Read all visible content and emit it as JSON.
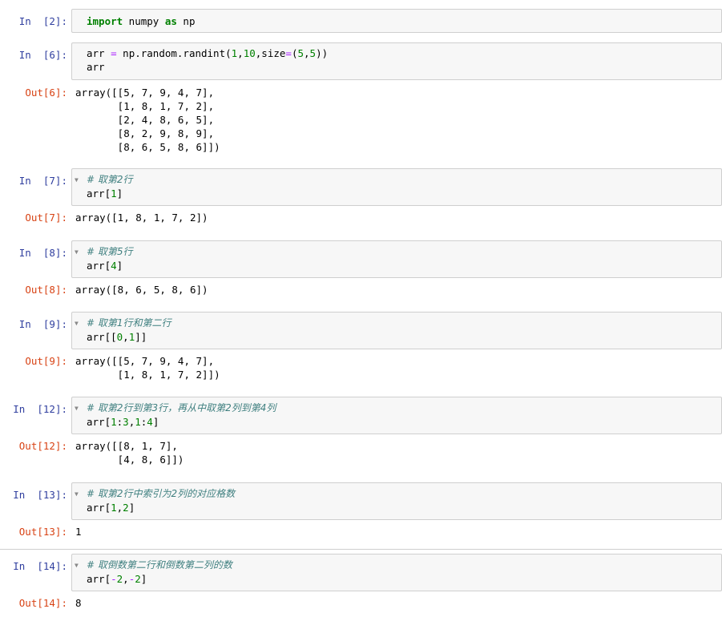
{
  "cells": [
    {
      "in_prompt": "In  [2]:",
      "code_lines": [
        [
          {
            "t": "import",
            "c": "kw"
          },
          {
            "t": " numpy "
          },
          {
            "t": "as",
            "c": "kw"
          },
          {
            "t": " np"
          }
        ]
      ]
    },
    {
      "in_prompt": "In  [6]:",
      "code_lines": [
        [
          {
            "t": "arr "
          },
          {
            "t": "=",
            "c": "op"
          },
          {
            "t": " np.random.randint("
          },
          {
            "t": "1",
            "c": "num"
          },
          {
            "t": ","
          },
          {
            "t": "10",
            "c": "num"
          },
          {
            "t": ",size"
          },
          {
            "t": "=",
            "c": "op"
          },
          {
            "t": "("
          },
          {
            "t": "5",
            "c": "num"
          },
          {
            "t": ","
          },
          {
            "t": "5",
            "c": "num"
          },
          {
            "t": "))"
          }
        ],
        [
          {
            "t": "arr"
          }
        ]
      ],
      "out_prompt": "Out[6]:",
      "output": "array([[5, 7, 9, 4, 7],\n       [1, 8, 1, 7, 2],\n       [2, 4, 8, 6, 5],\n       [8, 2, 9, 8, 9],\n       [8, 6, 5, 8, 6]])"
    },
    {
      "in_prompt": "In  [7]:",
      "code_lines": [
        [
          {
            "t": "# 取第2行",
            "c": "cmt"
          }
        ],
        [
          {
            "t": "arr["
          },
          {
            "t": "1",
            "c": "num"
          },
          {
            "t": "]"
          }
        ]
      ],
      "out_prompt": "Out[7]:",
      "output": "array([1, 8, 1, 7, 2])"
    },
    {
      "in_prompt": "In  [8]:",
      "code_lines": [
        [
          {
            "t": "# 取第5行",
            "c": "cmt"
          }
        ],
        [
          {
            "t": "arr["
          },
          {
            "t": "4",
            "c": "num"
          },
          {
            "t": "]"
          }
        ]
      ],
      "out_prompt": "Out[8]:",
      "output": "array([8, 6, 5, 8, 6])"
    },
    {
      "in_prompt": "In  [9]:",
      "code_lines": [
        [
          {
            "t": "# 取第1行和第二行",
            "c": "cmt"
          }
        ],
        [
          {
            "t": "arr[["
          },
          {
            "t": "0",
            "c": "num"
          },
          {
            "t": ","
          },
          {
            "t": "1",
            "c": "num"
          },
          {
            "t": "]]"
          }
        ]
      ],
      "out_prompt": "Out[9]:",
      "output": "array([[5, 7, 9, 4, 7],\n       [1, 8, 1, 7, 2]])"
    },
    {
      "in_prompt": "In  [12]:",
      "code_lines": [
        [
          {
            "t": "# 取第2行到第3行，再从中取第2列到第4列",
            "c": "cmt"
          }
        ],
        [
          {
            "t": "arr["
          },
          {
            "t": "1",
            "c": "num"
          },
          {
            "t": ":"
          },
          {
            "t": "3",
            "c": "num"
          },
          {
            "t": ","
          },
          {
            "t": "1",
            "c": "num"
          },
          {
            "t": ":"
          },
          {
            "t": "4",
            "c": "num"
          },
          {
            "t": "]"
          }
        ]
      ],
      "out_prompt": "Out[12]:",
      "output": "array([[8, 1, 7],\n       [4, 8, 6]])"
    },
    {
      "in_prompt": "In  [13]:",
      "code_lines": [
        [
          {
            "t": "# 取第2行中索引为2列的对应格数",
            "c": "cmt"
          }
        ],
        [
          {
            "t": "arr["
          },
          {
            "t": "1",
            "c": "num"
          },
          {
            "t": ","
          },
          {
            "t": "2",
            "c": "num"
          },
          {
            "t": "]"
          }
        ]
      ],
      "out_prompt": "Out[13]:",
      "output": "1"
    },
    {
      "in_prompt": "In  [14]:",
      "code_lines": [
        [
          {
            "t": "# 取倒数第二行和倒数第二列的数",
            "c": "cmt"
          }
        ],
        [
          {
            "t": "arr["
          },
          {
            "t": "-",
            "c": "op"
          },
          {
            "t": "2",
            "c": "num"
          },
          {
            "t": ","
          },
          {
            "t": "-",
            "c": "op"
          },
          {
            "t": "2",
            "c": "num"
          },
          {
            "t": "]"
          }
        ]
      ],
      "out_prompt": "Out[14]:",
      "output": "8"
    }
  ]
}
